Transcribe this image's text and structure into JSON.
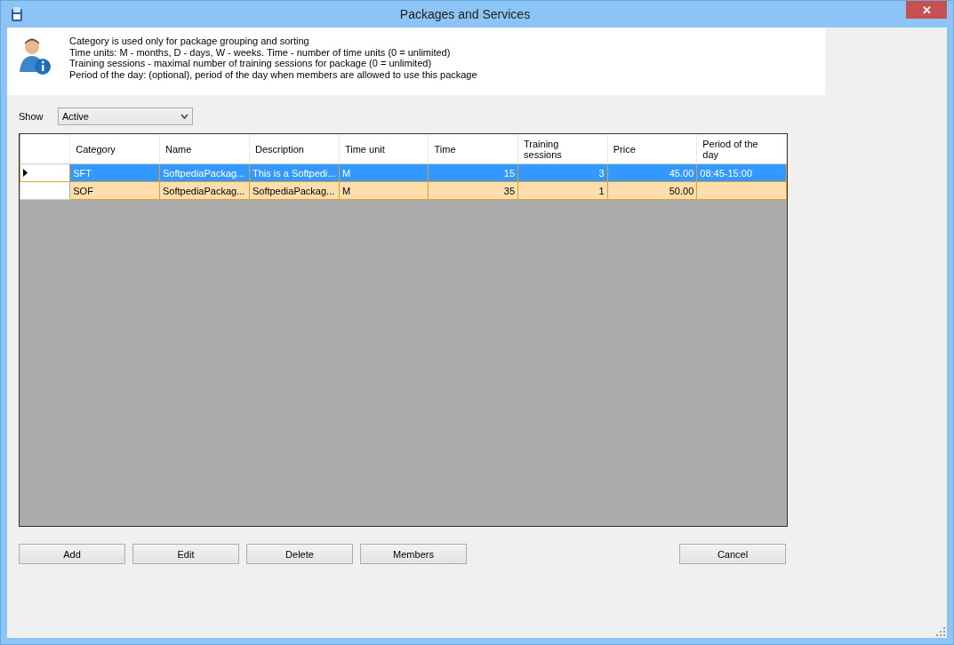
{
  "window": {
    "title": "Packages and Services",
    "close": "✕"
  },
  "info": {
    "lines": [
      "Category is used only for package grouping and sorting",
      "Time units: M - months, D - days, W - weeks. Time - number of time units (0 = unlimited)",
      "Training sessions - maximal number of training sessions for package (0 = unlimited)",
      "Period of the day: (optional), period of the day when members are allowed to use this package"
    ]
  },
  "show": {
    "label": "Show",
    "value": "Active"
  },
  "table": {
    "columns": [
      {
        "label": "Category",
        "kind": "text"
      },
      {
        "label": "Name",
        "kind": "text"
      },
      {
        "label": "Description",
        "kind": "text"
      },
      {
        "label": "Time unit",
        "kind": "text"
      },
      {
        "label": "Time",
        "kind": "number"
      },
      {
        "label": "Training sessions",
        "kind": "number"
      },
      {
        "label": "Price",
        "kind": "number"
      },
      {
        "label": "Period of the day",
        "kind": "text"
      }
    ],
    "rows": [
      {
        "selected": true,
        "current": true,
        "cells": [
          "SFT",
          "SoftpediaPackag...",
          "This is a Softpedi...",
          "M",
          "15",
          "3",
          "45.00",
          "08:45-15:00"
        ]
      },
      {
        "selected": false,
        "current": false,
        "cells": [
          "SOF",
          "SoftpediaPackag...",
          "SoftpediaPackag...",
          "M",
          "35",
          "1",
          "50.00",
          ""
        ]
      }
    ]
  },
  "buttons": [
    "Add",
    "Edit",
    "Delete",
    "Members"
  ],
  "cancel": "Cancel"
}
